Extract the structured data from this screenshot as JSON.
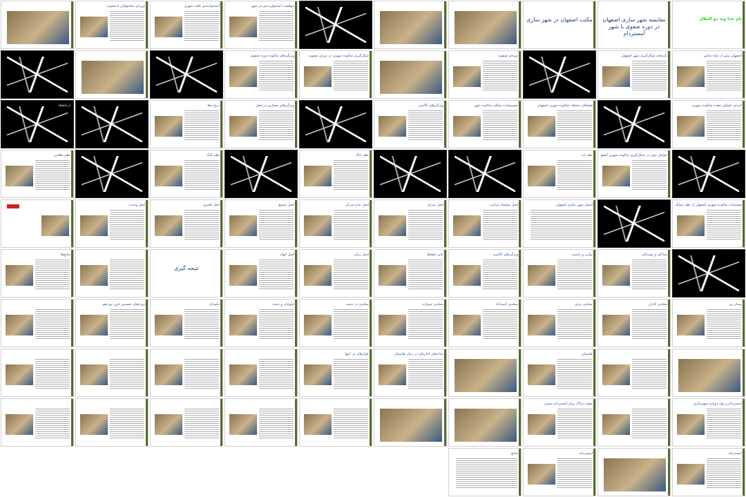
{
  "page": {
    "background": "#ffffff",
    "accent": "#2d5a9a",
    "green_text": "#22cc22"
  },
  "slides": [
    {
      "title": "نام خدا وند ذو الجلال",
      "kind": "green"
    },
    {
      "title": "مقایسه شهر سازی اصفهان در دوره صفوی با شهر آمستردام",
      "kind": "title"
    },
    {
      "title": "مکتب اصفهان در شهر سازی",
      "kind": "big"
    },
    {
      "title": "",
      "kind": "map-doc"
    },
    {
      "title": "",
      "kind": "photo"
    },
    {
      "title": "",
      "kind": "dark"
    },
    {
      "title": "موقعیت استخوان‌بندی در شهر",
      "kind": "text-img"
    },
    {
      "title": "استخوانبندی بافت شهری",
      "kind": "text-img"
    },
    {
      "title": "دوره‌ی سلجوقیان تا صفویه",
      "kind": "text-img"
    },
    {
      "title": "",
      "kind": "photo-color"
    },
    {
      "title": "اصفهان پیش از شاه عباس",
      "kind": "text-img"
    },
    {
      "title": "تاریخچه شکل‌گیری شهر اصفهان",
      "kind": "text-img"
    },
    {
      "title": "",
      "kind": "dark"
    },
    {
      "title": "دوره‌ی صفویه",
      "kind": "text-img"
    },
    {
      "title": "",
      "kind": "map"
    },
    {
      "title": "شکل‌گیری شالوده شهری در دوران صفویه",
      "kind": "text-img"
    },
    {
      "title": "ویژگی‌های شالوده دوره صفوی",
      "kind": "text-img"
    },
    {
      "title": "",
      "kind": "dark"
    },
    {
      "title": "",
      "kind": "photo"
    },
    {
      "title": "",
      "kind": "dark"
    },
    {
      "title": "اجزای تشکیل دهنده شالوده شهری",
      "kind": "text-img"
    },
    {
      "title": "",
      "kind": "dark"
    },
    {
      "title": "فضاهای مختلف شالوده شهری اصفهان",
      "kind": "text-img"
    },
    {
      "title": "خصوصیات شکلی شالوده شهر",
      "kind": "text-img"
    },
    {
      "title": "ویژگی‌های کالبدی",
      "kind": "text-img"
    },
    {
      "title": "",
      "kind": "dark"
    },
    {
      "title": "ویژگی‌های معماری در اصل",
      "kind": "text-img"
    },
    {
      "title": "دروازه‌ها",
      "kind": "text-img"
    },
    {
      "title": "",
      "kind": "dark"
    },
    {
      "title": "ارتباط‌ها",
      "kind": "dark"
    },
    {
      "title": "",
      "kind": "dark"
    },
    {
      "title": "عوامل موثر در شکل‌گیری شالوده شهری اصفهان",
      "kind": "text-img"
    },
    {
      "title": "نظم آب",
      "kind": "text-img"
    },
    {
      "title": "",
      "kind": "dark"
    },
    {
      "title": "",
      "kind": "dark"
    },
    {
      "title": "نظم خاک",
      "kind": "text-img"
    },
    {
      "title": "",
      "kind": "dark"
    },
    {
      "title": "نظم گیاه",
      "kind": "text-img"
    },
    {
      "title": "",
      "kind": "dark"
    },
    {
      "title": "نظم نظامی",
      "kind": "text-img"
    },
    {
      "title": "تقسیمات شالوده شهری اصفهان از نظر عملکردی",
      "kind": "text-img"
    },
    {
      "title": "",
      "kind": "dark"
    },
    {
      "title": "اصول شهر سازی اصفهان",
      "kind": "text"
    },
    {
      "title": "اصل سلسله مراتب",
      "kind": "text-img"
    },
    {
      "title": "اصل تمرکز",
      "kind": "text-img"
    },
    {
      "title": "اصل عدم تمرکز",
      "kind": "text-img"
    },
    {
      "title": "اصل تجمیع",
      "kind": "text-img"
    },
    {
      "title": "اصل قلمرو",
      "kind": "text-img"
    },
    {
      "title": "اصل وحدت",
      "kind": "text-img"
    },
    {
      "title": "",
      "kind": "logo"
    },
    {
      "title": "",
      "kind": "dark"
    },
    {
      "title": "سادگی و پیچیدگی",
      "kind": "text-img"
    },
    {
      "title": "توازن و تناسب",
      "kind": "text-img"
    },
    {
      "title": "ویژگی‌های کالبدی",
      "kind": "text-img"
    },
    {
      "title": "تباین فضاها",
      "kind": "text-img"
    },
    {
      "title": "اصل زمان",
      "kind": "text-img"
    },
    {
      "title": "اصل ابهام",
      "kind": "text-img"
    },
    {
      "title": "نتیجه گیری",
      "kind": "big"
    },
    {
      "title": "",
      "kind": "text-img"
    },
    {
      "title": "منابع‌ها",
      "kind": "text-img"
    },
    {
      "title": "میدان نو",
      "kind": "text-img"
    },
    {
      "title": "محله‌ی کاران",
      "kind": "text-img"
    },
    {
      "title": "محله‌ی یزدی",
      "kind": "text-img"
    },
    {
      "title": "محله‌ی احمدآباد",
      "kind": "text-img"
    },
    {
      "title": "محله‌ی جویباره",
      "kind": "text-img"
    },
    {
      "title": "محله‌ی در دشت",
      "kind": "text-img"
    },
    {
      "title": "جلوخان و دشته",
      "kind": "text-img"
    },
    {
      "title": "جلوخان",
      "kind": "text-img"
    },
    {
      "title": "دوره‌های نخستین قرن نوزدهم",
      "kind": "text-img"
    },
    {
      "title": "",
      "kind": "text-img"
    },
    {
      "title": "",
      "kind": "map"
    },
    {
      "title": "",
      "kind": "text-img"
    },
    {
      "title": "هاسمان",
      "kind": "text-img"
    },
    {
      "title": "",
      "kind": "photo-aerial"
    },
    {
      "title": "شانه‌های اجاره‌ای در زمان هاسمان",
      "kind": "text-img"
    },
    {
      "title": "بلوارهای بی انتها",
      "kind": "text-img"
    },
    {
      "title": "",
      "kind": "text-img"
    },
    {
      "title": "",
      "kind": "text-img"
    },
    {
      "title": "",
      "kind": "text-img"
    },
    {
      "title": "",
      "kind": "text-img"
    },
    {
      "title": "آمستردام و تولد دوباره شهرسازی",
      "kind": "text-img"
    },
    {
      "title": "",
      "kind": "text-img"
    },
    {
      "title": "نقشه برلاگ برای آمستردام جنوبی",
      "kind": "text-img"
    },
    {
      "title": "",
      "kind": "photo-aerial"
    },
    {
      "title": "",
      "kind": "map"
    },
    {
      "title": "",
      "kind": "text-img"
    },
    {
      "title": "",
      "kind": "text-img"
    },
    {
      "title": "",
      "kind": "text-img"
    },
    {
      "title": "",
      "kind": "text-img"
    },
    {
      "title": "",
      "kind": "text-img"
    },
    {
      "title": "آمستردام",
      "kind": "text-img"
    },
    {
      "title": "",
      "kind": "map-doc"
    },
    {
      "title": "آمستردام",
      "kind": "text-img"
    },
    {
      "title": "منابع",
      "kind": "text"
    }
  ]
}
